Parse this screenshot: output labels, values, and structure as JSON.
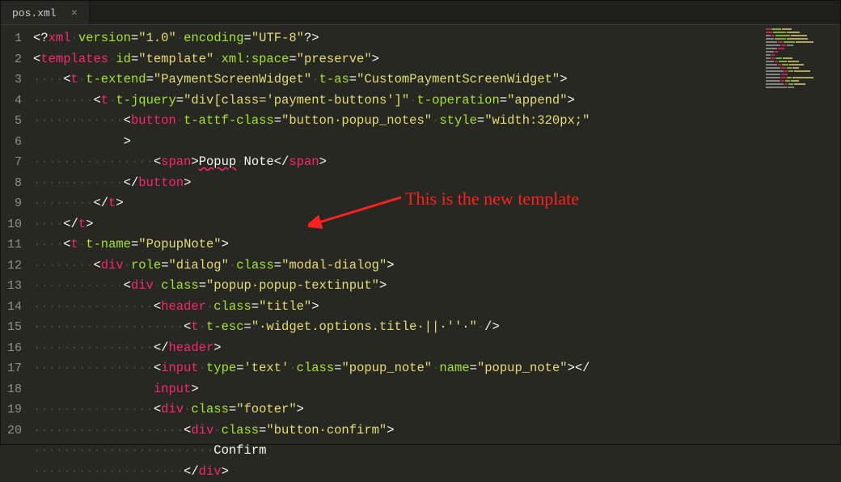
{
  "tab": {
    "title": "pos.xml"
  },
  "annotation": "This is the new template",
  "gutter": [
    "1",
    "2",
    "3",
    "4",
    "5",
    "6",
    "7",
    "8",
    "9",
    "10",
    "11",
    "12",
    "13",
    "14",
    "15",
    "16",
    "17",
    "18",
    "19",
    "20"
  ],
  "lines": [
    [
      {
        "c": "p",
        "t": "<?"
      },
      {
        "c": "tg",
        "t": "xml"
      },
      {
        "c": "ws",
        "t": "·"
      },
      {
        "c": "at",
        "t": "version"
      },
      {
        "c": "p",
        "t": "="
      },
      {
        "c": "st",
        "t": "\"1.0\""
      },
      {
        "c": "ws",
        "t": "·"
      },
      {
        "c": "at",
        "t": "encoding"
      },
      {
        "c": "p",
        "t": "="
      },
      {
        "c": "st",
        "t": "\"UTF-8\""
      },
      {
        "c": "p",
        "t": "?>"
      }
    ],
    [
      {
        "c": "p",
        "t": "<"
      },
      {
        "c": "tg",
        "t": "templates"
      },
      {
        "c": "ws",
        "t": "·"
      },
      {
        "c": "at",
        "t": "id"
      },
      {
        "c": "p",
        "t": "="
      },
      {
        "c": "st",
        "t": "\"template\""
      },
      {
        "c": "ws",
        "t": "·"
      },
      {
        "c": "at",
        "t": "xml:space"
      },
      {
        "c": "p",
        "t": "="
      },
      {
        "c": "st",
        "t": "\"preserve\""
      },
      {
        "c": "p",
        "t": ">"
      }
    ],
    [
      {
        "c": "ws",
        "t": "····"
      },
      {
        "c": "p",
        "t": "<"
      },
      {
        "c": "tg",
        "t": "t"
      },
      {
        "c": "ws",
        "t": "·"
      },
      {
        "c": "at",
        "t": "t-extend"
      },
      {
        "c": "p",
        "t": "="
      },
      {
        "c": "st",
        "t": "\"PaymentScreenWidget\""
      },
      {
        "c": "ws",
        "t": "·"
      },
      {
        "c": "at",
        "t": "t-as"
      },
      {
        "c": "p",
        "t": "="
      },
      {
        "c": "st",
        "t": "\"CustomPaymentScreenWidget\""
      },
      {
        "c": "p",
        "t": ">"
      }
    ],
    [
      {
        "c": "ws",
        "t": "········"
      },
      {
        "c": "p",
        "t": "<"
      },
      {
        "c": "tg",
        "t": "t"
      },
      {
        "c": "ws",
        "t": "·"
      },
      {
        "c": "at",
        "t": "t-jquery"
      },
      {
        "c": "p",
        "t": "="
      },
      {
        "c": "st",
        "t": "\"div[class='payment-buttons']\""
      },
      {
        "c": "ws",
        "t": "·"
      },
      {
        "c": "at",
        "t": "t-operation"
      },
      {
        "c": "p",
        "t": "="
      },
      {
        "c": "st",
        "t": "\"append\""
      },
      {
        "c": "p",
        "t": ">"
      }
    ],
    [
      {
        "c": "ws",
        "t": "············"
      },
      {
        "c": "p",
        "t": "<"
      },
      {
        "c": "tg",
        "t": "button"
      },
      {
        "c": "ws",
        "t": "·"
      },
      {
        "c": "at",
        "t": "t-attf-class"
      },
      {
        "c": "p",
        "t": "="
      },
      {
        "c": "st",
        "t": "\"button·popup_notes\""
      },
      {
        "c": "ws",
        "t": "·"
      },
      {
        "c": "at",
        "t": "style"
      },
      {
        "c": "p",
        "t": "="
      },
      {
        "c": "st",
        "t": "\"width:320px;\""
      },
      {
        "c": "p",
        "t": "\n            >"
      }
    ],
    [
      {
        "c": "ws",
        "t": "················"
      },
      {
        "c": "p",
        "t": "<"
      },
      {
        "c": "tg",
        "t": "span"
      },
      {
        "c": "p",
        "t": ">"
      },
      {
        "c": "tx err",
        "t": "Popup"
      },
      {
        "c": "ws",
        "t": "·"
      },
      {
        "c": "tx",
        "t": "Note"
      },
      {
        "c": "p",
        "t": "</"
      },
      {
        "c": "tg",
        "t": "span"
      },
      {
        "c": "p",
        "t": ">"
      }
    ],
    [
      {
        "c": "ws",
        "t": "············"
      },
      {
        "c": "p",
        "t": "</"
      },
      {
        "c": "tg",
        "t": "button"
      },
      {
        "c": "p",
        "t": ">"
      }
    ],
    [
      {
        "c": "ws",
        "t": "········"
      },
      {
        "c": "p",
        "t": "</"
      },
      {
        "c": "tg",
        "t": "t"
      },
      {
        "c": "p",
        "t": ">"
      }
    ],
    [
      {
        "c": "ws",
        "t": "····"
      },
      {
        "c": "p",
        "t": "</"
      },
      {
        "c": "tg",
        "t": "t"
      },
      {
        "c": "p",
        "t": ">"
      }
    ],
    [
      {
        "c": "ws",
        "t": "····"
      },
      {
        "c": "p",
        "t": "<"
      },
      {
        "c": "tg",
        "t": "t"
      },
      {
        "c": "ws",
        "t": "·"
      },
      {
        "c": "at",
        "t": "t-name"
      },
      {
        "c": "p",
        "t": "="
      },
      {
        "c": "st",
        "t": "\"PopupNote\""
      },
      {
        "c": "p",
        "t": ">"
      }
    ],
    [
      {
        "c": "ws",
        "t": "········"
      },
      {
        "c": "p",
        "t": "<"
      },
      {
        "c": "tg",
        "t": "div"
      },
      {
        "c": "ws",
        "t": "·"
      },
      {
        "c": "at",
        "t": "role"
      },
      {
        "c": "p",
        "t": "="
      },
      {
        "c": "st",
        "t": "\"dialog\""
      },
      {
        "c": "ws",
        "t": "·"
      },
      {
        "c": "at",
        "t": "class"
      },
      {
        "c": "p",
        "t": "="
      },
      {
        "c": "st",
        "t": "\"modal-dialog\""
      },
      {
        "c": "p",
        "t": ">"
      }
    ],
    [
      {
        "c": "ws",
        "t": "············"
      },
      {
        "c": "p",
        "t": "<"
      },
      {
        "c": "tg",
        "t": "div"
      },
      {
        "c": "ws",
        "t": "·"
      },
      {
        "c": "at",
        "t": "class"
      },
      {
        "c": "p",
        "t": "="
      },
      {
        "c": "st",
        "t": "\"popup·popup-textinput\""
      },
      {
        "c": "p",
        "t": ">"
      }
    ],
    [
      {
        "c": "ws",
        "t": "················"
      },
      {
        "c": "p",
        "t": "<"
      },
      {
        "c": "tg",
        "t": "header"
      },
      {
        "c": "ws",
        "t": "·"
      },
      {
        "c": "at",
        "t": "class"
      },
      {
        "c": "p",
        "t": "="
      },
      {
        "c": "st",
        "t": "\"title\""
      },
      {
        "c": "p",
        "t": ">"
      }
    ],
    [
      {
        "c": "ws",
        "t": "····················"
      },
      {
        "c": "p",
        "t": "<"
      },
      {
        "c": "tg",
        "t": "t"
      },
      {
        "c": "ws",
        "t": "·"
      },
      {
        "c": "at",
        "t": "t-esc"
      },
      {
        "c": "p",
        "t": "="
      },
      {
        "c": "st",
        "t": "\"·widget.options.title·||·''·\""
      },
      {
        "c": "ws",
        "t": "·"
      },
      {
        "c": "p",
        "t": "/>"
      }
    ],
    [
      {
        "c": "ws",
        "t": "················"
      },
      {
        "c": "p",
        "t": "</"
      },
      {
        "c": "tg",
        "t": "header"
      },
      {
        "c": "p",
        "t": ">"
      }
    ],
    [
      {
        "c": "ws",
        "t": "················"
      },
      {
        "c": "p",
        "t": "<"
      },
      {
        "c": "tg",
        "t": "input"
      },
      {
        "c": "ws",
        "t": "·"
      },
      {
        "c": "at",
        "t": "type"
      },
      {
        "c": "p",
        "t": "="
      },
      {
        "c": "st",
        "t": "'text'"
      },
      {
        "c": "ws",
        "t": "·"
      },
      {
        "c": "at",
        "t": "class"
      },
      {
        "c": "p",
        "t": "="
      },
      {
        "c": "st",
        "t": "\"popup_note\""
      },
      {
        "c": "ws",
        "t": "·"
      },
      {
        "c": "at",
        "t": "name"
      },
      {
        "c": "p",
        "t": "="
      },
      {
        "c": "st",
        "t": "\"popup_note\""
      },
      {
        "c": "p",
        "t": "></\n                "
      },
      {
        "c": "tg",
        "t": "input"
      },
      {
        "c": "p",
        "t": ">"
      }
    ],
    [
      {
        "c": "ws",
        "t": "················"
      },
      {
        "c": "p",
        "t": "<"
      },
      {
        "c": "tg",
        "t": "div"
      },
      {
        "c": "ws",
        "t": "·"
      },
      {
        "c": "at",
        "t": "class"
      },
      {
        "c": "p",
        "t": "="
      },
      {
        "c": "st",
        "t": "\"footer\""
      },
      {
        "c": "p",
        "t": ">"
      }
    ],
    [
      {
        "c": "ws",
        "t": "····················"
      },
      {
        "c": "p",
        "t": "<"
      },
      {
        "c": "tg",
        "t": "div"
      },
      {
        "c": "ws",
        "t": "·"
      },
      {
        "c": "at",
        "t": "class"
      },
      {
        "c": "p",
        "t": "="
      },
      {
        "c": "st",
        "t": "\"button·confirm\""
      },
      {
        "c": "p",
        "t": ">"
      }
    ],
    [
      {
        "c": "ws",
        "t": "························"
      },
      {
        "c": "tx",
        "t": "Confirm"
      }
    ],
    [
      {
        "c": "ws",
        "t": "····················"
      },
      {
        "c": "p",
        "t": "</"
      },
      {
        "c": "tg",
        "t": "div"
      },
      {
        "c": "p",
        "t": ">"
      }
    ]
  ]
}
